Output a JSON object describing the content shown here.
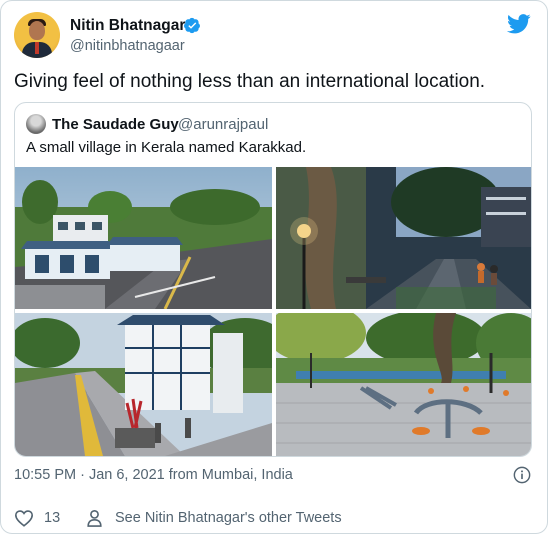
{
  "author": {
    "name": "Nitin Bhatnagar",
    "handle": "@nitinbhatnagaar",
    "verified": true,
    "avatar_icon": "profile-photo"
  },
  "tweet": {
    "text": "Giving feel of nothing less than an international location."
  },
  "quoted": {
    "name": "The Saudade Guy",
    "handle": "@arunrajpaul",
    "text": "A small village in Kerala named Karakkad.",
    "images": [
      "village-road-with-kiosks",
      "lamp-lit-walkway",
      "blue-white-kiosk-tiled-path",
      "outdoor-gym-park"
    ]
  },
  "meta": {
    "timestamp": "10:55 PM · Jan 6, 2021 from Mumbai, India"
  },
  "actions": {
    "like_count": "13",
    "other_tweets": "See Nitin Bhatnagar's other Tweets"
  },
  "colors": {
    "twitter_blue": "#1d9bf0",
    "secondary_text": "#536471",
    "border": "#cfd9de"
  }
}
